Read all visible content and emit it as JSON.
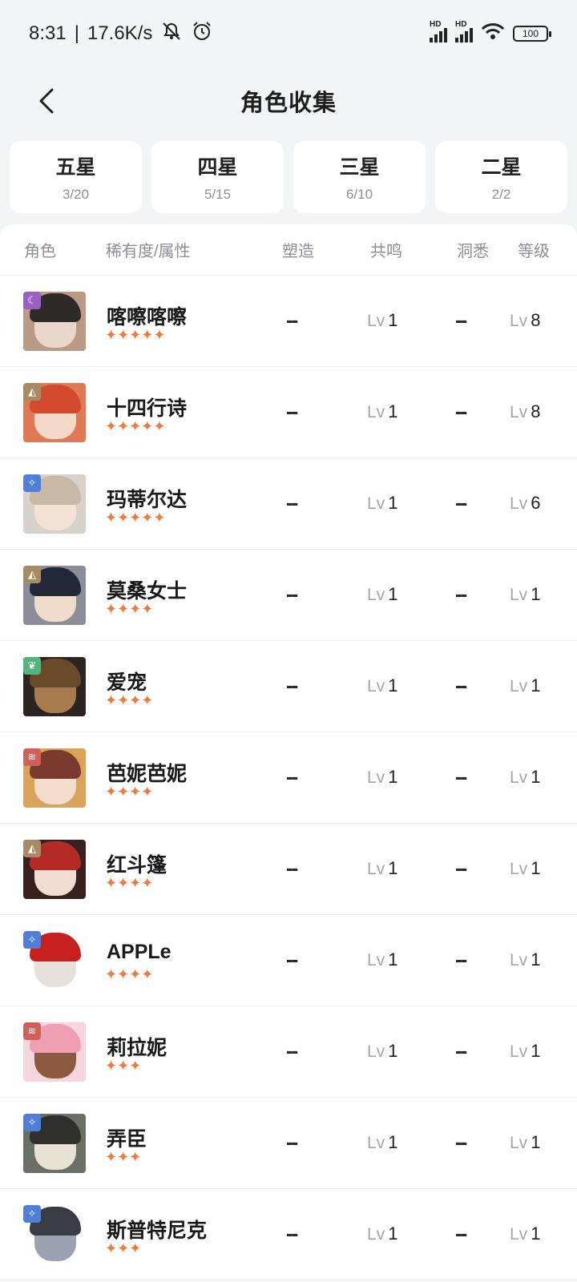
{
  "status_bar": {
    "time": "8:31",
    "speed": "17.6K/s",
    "hd1": "HD",
    "hd2": "HD",
    "battery": "100"
  },
  "header": {
    "title": "角色收集"
  },
  "tabs": [
    {
      "label": "五星",
      "count": "3/20"
    },
    {
      "label": "四星",
      "count": "5/15"
    },
    {
      "label": "三星",
      "count": "6/10"
    },
    {
      "label": "二星",
      "count": "2/2"
    }
  ],
  "table": {
    "headers": {
      "role": "角色",
      "rarity": "稀有度/属性",
      "forge": "塑造",
      "reso": "共鸣",
      "insight": "洞悉",
      "level": "等级"
    },
    "lv_prefix": "Lv",
    "rows": [
      {
        "name": "喀嚓喀嚓",
        "stars": "✦✦✦✦✦",
        "forge": "--",
        "reso": "1",
        "insight": "--",
        "level": "8",
        "badge_color": "#9b5fc0",
        "badge_icon": "moon-icon",
        "badge_glyph": "☾",
        "hair_color": "#2e2a28",
        "skin_color": "#e8d6c8",
        "bg_color": "#b89a86"
      },
      {
        "name": "十四行诗",
        "stars": "✦✦✦✦✦",
        "forge": "--",
        "reso": "1",
        "insight": "--",
        "level": "8",
        "badge_color": "#a88b63",
        "badge_icon": "rock-icon",
        "badge_glyph": "◭",
        "hair_color": "#d34a2e",
        "skin_color": "#f3d8c8",
        "bg_color": "#e07a55"
      },
      {
        "name": "玛蒂尔达",
        "stars": "✦✦✦✦✦",
        "forge": "--",
        "reso": "1",
        "insight": "--",
        "level": "6",
        "badge_color": "#4f7fd6",
        "badge_icon": "star-icon",
        "badge_glyph": "✧",
        "hair_color": "#c9b8a6",
        "skin_color": "#f2e2d6",
        "bg_color": "#d8d2cc"
      },
      {
        "name": "莫桑女士",
        "stars": "✦✦✦✦",
        "forge": "--",
        "reso": "1",
        "insight": "--",
        "level": "1",
        "badge_color": "#a88b63",
        "badge_icon": "rock-icon",
        "badge_glyph": "◭",
        "hair_color": "#23273a",
        "skin_color": "#f0dccb",
        "bg_color": "#8b8e98"
      },
      {
        "name": "爱宠",
        "stars": "✦✦✦✦",
        "forge": "--",
        "reso": "1",
        "insight": "--",
        "level": "1",
        "badge_color": "#55b47a",
        "badge_icon": "leaf-icon",
        "badge_glyph": "❦",
        "hair_color": "#6b4a2c",
        "skin_color": "#a87b4f",
        "bg_color": "#2b2420"
      },
      {
        "name": "芭妮芭妮",
        "stars": "✦✦✦✦",
        "forge": "--",
        "reso": "1",
        "insight": "--",
        "level": "1",
        "badge_color": "#d0605a",
        "badge_icon": "wave-icon",
        "badge_glyph": "≋",
        "hair_color": "#7a3b2e",
        "skin_color": "#f4dccc",
        "bg_color": "#d9a35a"
      },
      {
        "name": "红斗篷",
        "stars": "✦✦✦✦",
        "forge": "--",
        "reso": "1",
        "insight": "--",
        "level": "1",
        "badge_color": "#a88b63",
        "badge_icon": "rock-icon",
        "badge_glyph": "◭",
        "hair_color": "#b42a26",
        "skin_color": "#f2dcd0",
        "bg_color": "#3a1f1f"
      },
      {
        "name": "APPLe",
        "stars": "✦✦✦✦",
        "forge": "--",
        "reso": "1",
        "insight": "--",
        "level": "1",
        "badge_color": "#4f7fd6",
        "badge_icon": "star-icon",
        "badge_glyph": "✧",
        "hair_color": "#c8201e",
        "skin_color": "#e6e0dc",
        "bg_color": "#ffffff"
      },
      {
        "name": "莉拉妮",
        "stars": "✦✦✦",
        "forge": "--",
        "reso": "1",
        "insight": "--",
        "level": "1",
        "badge_color": "#d0605a",
        "badge_icon": "wave-icon",
        "badge_glyph": "≋",
        "hair_color": "#ef9fb4",
        "skin_color": "#8c5b3f",
        "bg_color": "#f6d6de"
      },
      {
        "name": "弄臣",
        "stars": "✦✦✦",
        "forge": "--",
        "reso": "1",
        "insight": "--",
        "level": "1",
        "badge_color": "#4f7fd6",
        "badge_icon": "star-icon",
        "badge_glyph": "✧",
        "hair_color": "#2f302c",
        "skin_color": "#e8e2d2",
        "bg_color": "#6b7066"
      },
      {
        "name": "斯普特尼克",
        "stars": "✦✦✦",
        "forge": "--",
        "reso": "1",
        "insight": "--",
        "level": "1",
        "badge_color": "#4f7fd6",
        "badge_icon": "star-icon",
        "badge_glyph": "✧",
        "hair_color": "#3a3c44",
        "skin_color": "#9aa2b4",
        "bg_color": "#ffffff"
      }
    ]
  }
}
